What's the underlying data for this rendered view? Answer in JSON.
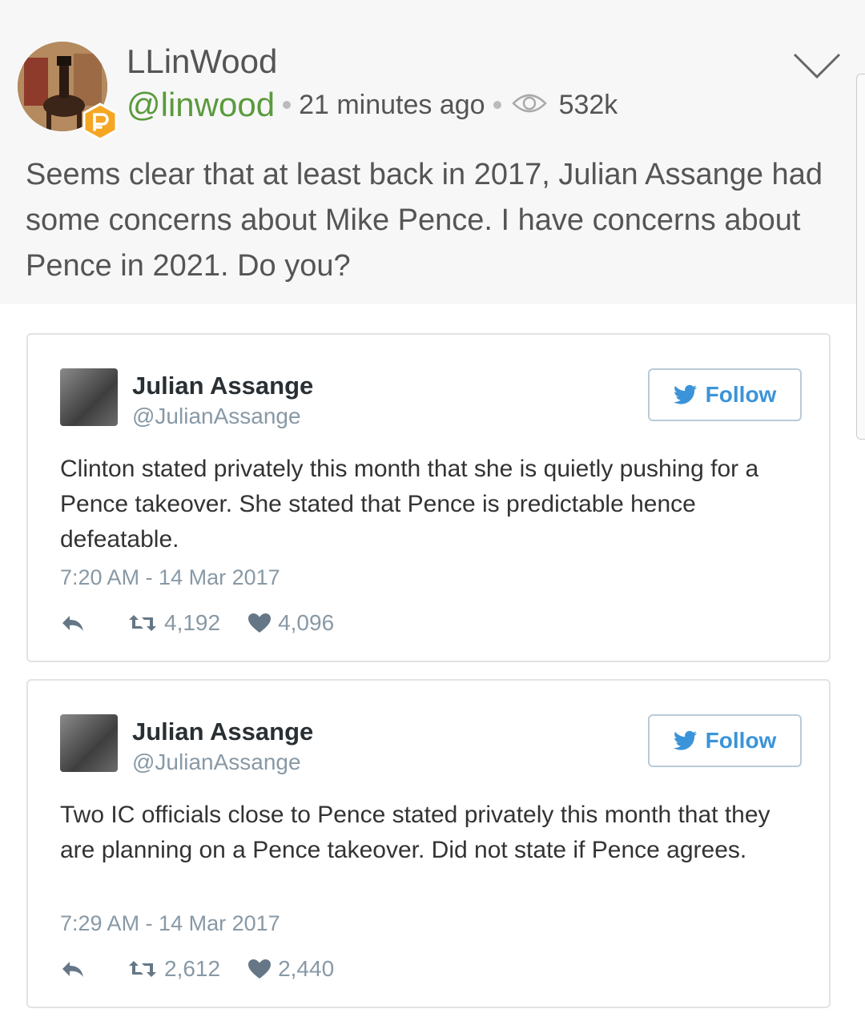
{
  "post": {
    "author_name": "LLinWood",
    "handle": "@linwood",
    "time_ago": "21 minutes ago",
    "views": "532k",
    "text": "Seems clear that at least back in 2017, Julian Assange had some concerns about Mike Pence. I have concerns about Pence in 2021. Do you?"
  },
  "tweets": [
    {
      "name": "Julian Assange",
      "handle": "@JulianAssange",
      "follow_label": "Follow",
      "text": "Clinton stated privately this month that she is quietly pushing for a Pence takeover. She stated that Pence is predictable hence defeatable.",
      "timestamp": "7:20 AM - 14 Mar 2017",
      "retweets": "4,192",
      "likes": "4,096"
    },
    {
      "name": "Julian Assange",
      "handle": "@JulianAssange",
      "follow_label": "Follow",
      "text": "Two IC officials close to Pence stated privately this month that they are planning on a Pence takeover. Did not state if Pence agrees.",
      "timestamp": "7:29 AM - 14 Mar 2017",
      "retweets": "2,612",
      "likes": "2,440"
    }
  ],
  "colors": {
    "handle_green": "#5a9a3c",
    "twitter_blue": "#3b94d9",
    "badge_orange": "#f5a623"
  },
  "icons": [
    "eye-icon",
    "chevron-down-icon",
    "twitter-bird-icon",
    "reply-icon",
    "retweet-icon",
    "heart-icon",
    "parler-badge-icon"
  ]
}
